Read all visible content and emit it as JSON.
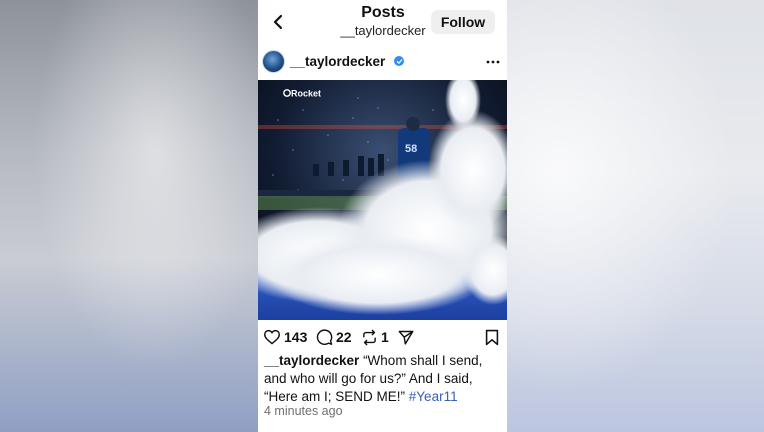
{
  "header": {
    "title": "Posts",
    "subtitle": "__taylordecker",
    "follow_label": "Follow"
  },
  "post": {
    "username": "__taylordecker",
    "verified": true,
    "image_overlay_text": "Rocket",
    "likes": "143",
    "comments": "22",
    "reposts": "1",
    "caption_user": "__taylordecker",
    "caption_text": " “Whom shall I send, and who will go for us?” And I said, “Here am I; SEND ME!” ",
    "caption_hashtag": "#Year11",
    "timestamp": "4 minutes ago"
  },
  "icons": {
    "back": "chevron-left-icon",
    "verified": "verified-badge-icon",
    "more": "more-horizontal-icon",
    "like": "heart-icon",
    "comment": "comment-icon",
    "repost": "repost-icon",
    "share": "share-icon",
    "save": "bookmark-icon"
  },
  "colors": {
    "verified": "#2f8cf0",
    "hashtag": "#3b5fb8",
    "follow_bg": "#efefef",
    "turf": "#2a55c4"
  }
}
